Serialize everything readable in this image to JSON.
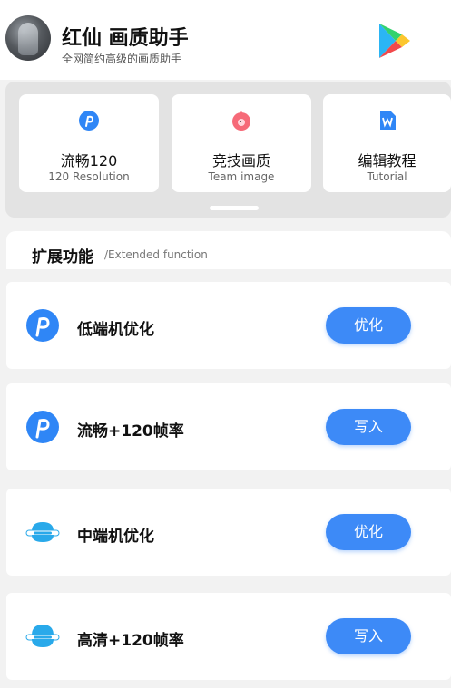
{
  "header": {
    "title": "红仙 画质助手",
    "subtitle": "全网简约高级的画质助手"
  },
  "features": [
    {
      "title": "流畅120",
      "subtitle": "120 Resolution",
      "icon": "p-logo-icon"
    },
    {
      "title": "竞技画质",
      "subtitle": "Team image",
      "icon": "bird-icon"
    },
    {
      "title": "编辑教程",
      "subtitle": "Tutorial",
      "icon": "document-w-icon"
    }
  ],
  "section": {
    "title": "扩展功能",
    "subtitle": "/Extended function"
  },
  "rows": [
    {
      "label": "低端机优化",
      "button": "优化",
      "icon": "p-logo-icon"
    },
    {
      "label": "流畅+120帧率",
      "button": "写入",
      "icon": "p-logo-icon"
    },
    {
      "label": "中端机优化",
      "button": "优化",
      "icon": "cloud-icon"
    },
    {
      "label": "高清+120帧率",
      "button": "写入",
      "icon": "cloud-icon"
    }
  ],
  "colors": {
    "accent": "#3d8af7",
    "background": "#f2f2f2"
  }
}
